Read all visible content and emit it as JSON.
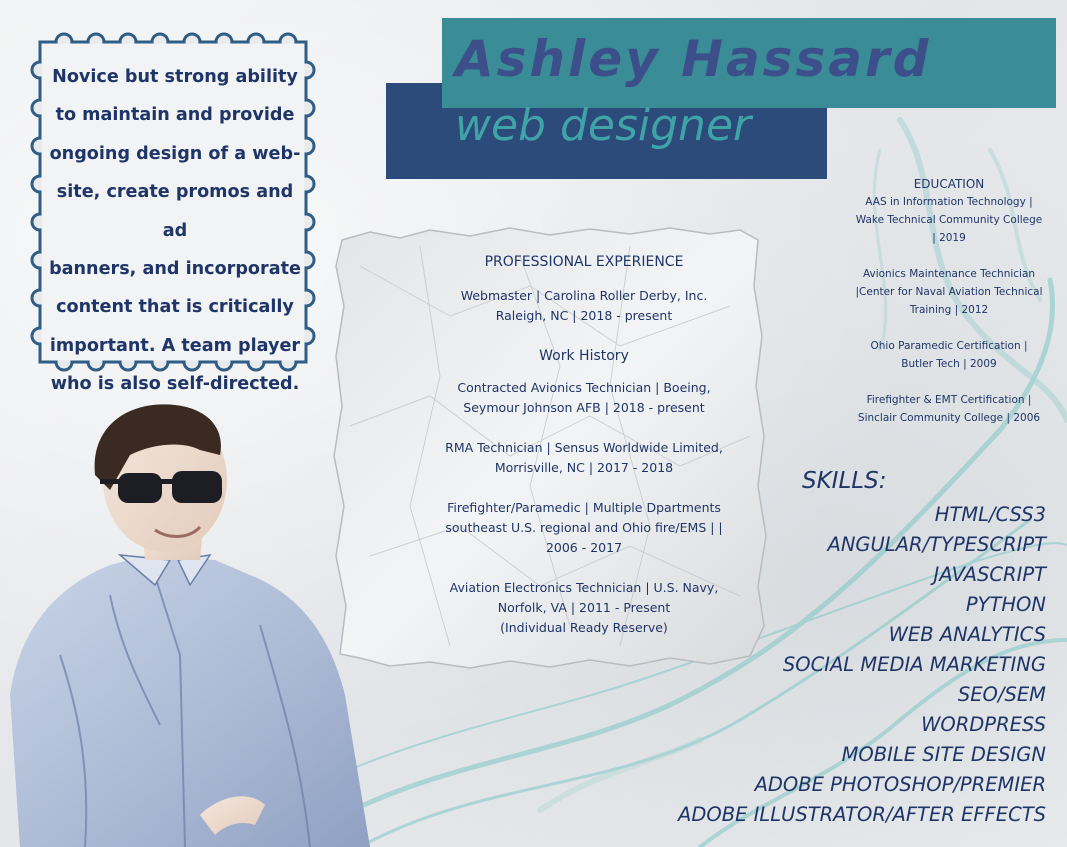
{
  "name": "Ashley Hassard",
  "title": "web designer",
  "summary": {
    "lines": [
      "Novice but strong ability",
      "to maintain and provide",
      "ongoing design of a web-",
      "site, create promos and ad",
      "banners, and incorporate",
      "content that is critically",
      "important.  A team player",
      "who is also self-directed."
    ]
  },
  "experience": {
    "heading": "PROFESSIONAL EXPERIENCE",
    "current": [
      "Webmaster | Carolina Roller Derby, Inc.",
      "Raleigh, NC | 2018 - present"
    ],
    "history_heading": "Work History",
    "jobs": [
      [
        "Contracted Avionics Technician | Boeing,",
        "Seymour Johnson AFB | 2018 - present"
      ],
      [
        "RMA Technician | Sensus Worldwide Limited,",
        "Morrisville, NC | 2017 - 2018"
      ],
      [
        "Firefighter/Paramedic | Multiple Dpartments",
        "southeast U.S. regional and Ohio fire/EMS | |",
        "2006 - 2017"
      ],
      [
        "Aviation Electronics Technician | U.S. Navy,",
        "Norfolk, VA | 2011 - Present",
        "(Individual Ready Reserve)"
      ]
    ]
  },
  "education": {
    "heading": "EDUCATION",
    "entries": [
      [
        "AAS in Information Technology |",
        "Wake Technical Community College",
        "| 2019"
      ],
      [
        "Avionics Maintenance Technician",
        "|Center for Naval Aviation Technical",
        "Training | 2012"
      ],
      [
        "Ohio Paramedic Certification |",
        "Butler Tech | 2009"
      ],
      [
        "Firefighter & EMT Certification |",
        "Sinclair Community College | 2006"
      ]
    ]
  },
  "skills": {
    "heading": "SKILLS:",
    "items": [
      "HTML/CSS3",
      "ANGULAR/TYPESCRIPT",
      "JAVASCRIPT",
      "PYTHON",
      "WEB ANALYTICS",
      "SOCIAL MEDIA MARKETING",
      "SEO/SEM",
      "WORDPRESS",
      "MOBILE SITE DESIGN",
      "ADOBE PHOTOSHOP/PREMIER",
      "ADOBE ILLUSTRATOR/AFTER EFFECTS"
    ]
  },
  "colors": {
    "navy_text": "#1f3568",
    "teal_banner": "#3a8c96",
    "navy_banner": "#2c4a7a",
    "name_text": "#3c4f8a",
    "title_text": "#3fa3a8",
    "swirl": "#7fc7c4"
  }
}
